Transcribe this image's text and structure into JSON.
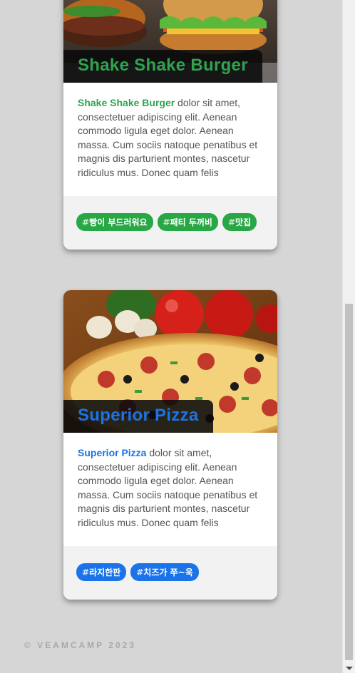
{
  "cards": [
    {
      "title": "Shake Shake Burger",
      "title_color": "#2ea44f",
      "desc_lead": "Shake Shake Burger",
      "desc_rest": " dolor sit amet, consectetuer adipiscing elit. Aenean commodo ligula eget dolor. Aenean massa. Cum sociis natoque penatibus et magnis dis parturient montes, nascetur ridiculus mus. Donec quam felis",
      "tag_color": "#28a745",
      "tags": [
        "빵이 부드러워요",
        "패티 두꺼비",
        "맛집"
      ],
      "image": "burger-photo"
    },
    {
      "title": "Superior Pizza",
      "title_color": "#1a73e8",
      "desc_lead": "Superior Pizza",
      "desc_rest": " dolor sit amet, consectetuer adipiscing elit. Aenean commodo ligula eget dolor. Aenean massa. Cum sociis natoque penatibus et magnis dis parturient montes, nascetur ridiculus mus. Donec quam felis",
      "tag_color": "#1a73e8",
      "tags": [
        "라지한판",
        "치즈가 쭈~욱"
      ],
      "image": "pizza-photo"
    }
  ],
  "tag_prefix": "#",
  "footer": "© VEAMCAMP 2023"
}
